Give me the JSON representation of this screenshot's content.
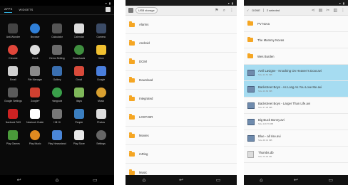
{
  "launcher": {
    "tabs": [
      {
        "label": "APPS"
      },
      {
        "label": "WIDGETS"
      }
    ],
    "apps": [
      {
        "label": "Anti-Wonder",
        "icon": "speaker-icon",
        "color": "#444444",
        "round": false
      },
      {
        "label": "Browser",
        "icon": "globe-icon",
        "color": "#2f7fd8",
        "round": true
      },
      {
        "label": "Calculator",
        "icon": "calculator-icon",
        "color": "#555555",
        "round": false
      },
      {
        "label": "Calendar",
        "icon": "calendar-icon",
        "color": "#dcdcdc",
        "round": false
      },
      {
        "label": "Camera",
        "icon": "camera-icon",
        "color": "#3b4b66",
        "round": false
      },
      {
        "label": "Chrome",
        "icon": "chrome-icon",
        "color": "#e0463a",
        "round": true
      },
      {
        "label": "Clock",
        "icon": "clock-icon",
        "color": "#dddddd",
        "round": true
      },
      {
        "label": "Demo Setting",
        "icon": "wrench-icon",
        "color": "#6b6b6b",
        "round": false
      },
      {
        "label": "Downloads",
        "icon": "download-icon",
        "color": "#3f8f3f",
        "round": true
      },
      {
        "label": "Drive",
        "icon": "drive-icon",
        "color": "#f0c030",
        "round": false
      },
      {
        "label": "Email",
        "icon": "mail-icon",
        "color": "#d0d0d0",
        "round": false
      },
      {
        "label": "File Manager",
        "icon": "folder-icon",
        "color": "#8a8a8a",
        "round": false
      },
      {
        "label": "Gallery",
        "icon": "gallery-icon",
        "color": "#3a6fb0",
        "round": false
      },
      {
        "label": "Gmail",
        "icon": "gmail-icon",
        "color": "#d84a3a",
        "round": false
      },
      {
        "label": "Google",
        "icon": "google-icon",
        "color": "#4a7fdd",
        "round": false
      },
      {
        "label": "Google Settings",
        "icon": "google-settings-icon",
        "color": "#5a5a5a",
        "round": false
      },
      {
        "label": "Google+",
        "icon": "googleplus-icon",
        "color": "#d04030",
        "round": false
      },
      {
        "label": "Hangouts",
        "icon": "hangouts-icon",
        "color": "#3aa04a",
        "round": true
      },
      {
        "label": "Maps",
        "icon": "map-icon",
        "color": "#7fb85a",
        "round": false
      },
      {
        "label": "Music",
        "icon": "headphones-icon",
        "color": "#d8a030",
        "round": true
      },
      {
        "label": "Navbook TAG",
        "icon": "nfc-icon",
        "color": "#cc2222",
        "round": false
      },
      {
        "label": "Navbook Guide",
        "icon": "guide-icon",
        "color": "#ffffff",
        "round": false
      },
      {
        "label": "Hill Hi",
        "icon": "phone-icon",
        "color": "#777777",
        "round": false
      },
      {
        "label": "People",
        "icon": "people-icon",
        "color": "#3b7fc0",
        "round": false
      },
      {
        "label": "Photos",
        "icon": "photos-icon",
        "color": "#dddddd",
        "round": false
      },
      {
        "label": "Play Games",
        "icon": "gamepad-icon",
        "color": "#4a9a3a",
        "round": false
      },
      {
        "label": "Play Music",
        "icon": "headphones-icon",
        "color": "#e08a20",
        "round": true
      },
      {
        "label": "Play Newsstand",
        "icon": "news-icon",
        "color": "#4a86d8",
        "round": false
      },
      {
        "label": "Play Store",
        "icon": "store-icon",
        "color": "#e8e8e8",
        "round": false
      },
      {
        "label": "Settings",
        "icon": "gear-icon",
        "color": "#666666",
        "round": true
      }
    ]
  },
  "filemanager": {
    "breadcrumb": "USB storage",
    "folders": [
      {
        "name": "Alarms"
      },
      {
        "name": "Android"
      },
      {
        "name": "DCIM"
      },
      {
        "name": "Download"
      },
      {
        "name": "Integrated"
      },
      {
        "name": "LOST.DIR"
      },
      {
        "name": "Movies"
      },
      {
        "name": "mRing"
      },
      {
        "name": "Music"
      }
    ]
  },
  "selection": {
    "done_label": "DONE",
    "count_label": "2 selected",
    "rows": [
      {
        "name": "PV Nova",
        "meta": "",
        "type": "folder",
        "selected": false
      },
      {
        "name": "The Mammy Novas",
        "meta": "",
        "type": "folder",
        "selected": false
      },
      {
        "name": "Wes Burden",
        "meta": "",
        "type": "folder",
        "selected": false
      },
      {
        "name": "Avril Lavigne - Knocking On Heaven's Door.avi",
        "meta": "Size 22.51 MB",
        "type": "video",
        "selected": true
      },
      {
        "name": "Backstreet Boys - As Long As You Love Me.avi",
        "meta": "Size 19.69 MB",
        "type": "video",
        "selected": true
      },
      {
        "name": "Backstreet Boys - Larger Than Life.avi",
        "meta": "Size 37.28 MB",
        "type": "video",
        "selected": false
      },
      {
        "name": "Big Buck Bunny.avi",
        "meta": "Size 149.79 MB",
        "type": "video",
        "selected": false
      },
      {
        "name": "Blue - all rise.avi",
        "meta": "Size 48.31 MB",
        "type": "video",
        "selected": false
      },
      {
        "name": "Thumbs.db",
        "meta": "Size 79.00 KB",
        "type": "doc",
        "selected": false
      }
    ]
  }
}
